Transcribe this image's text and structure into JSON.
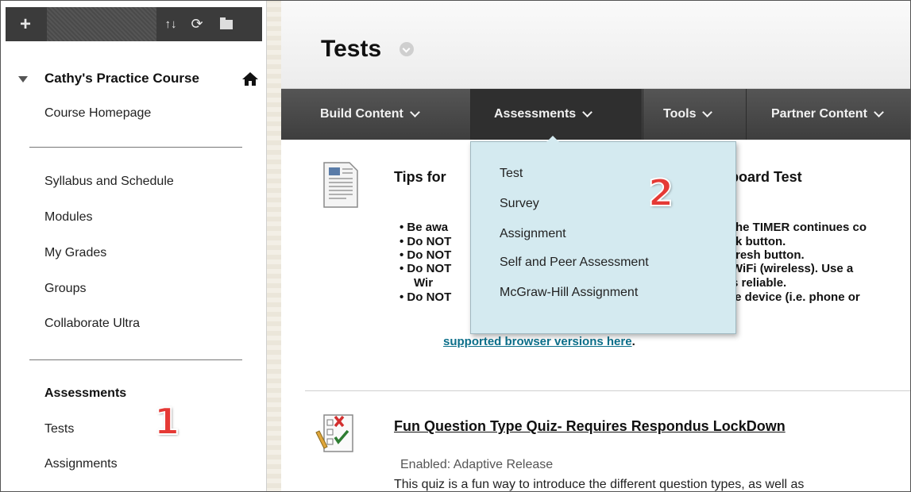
{
  "toolbar": {
    "plus_icon": "+",
    "sort_icon": "↑↓",
    "refresh_icon": "⟳"
  },
  "sidebar": {
    "course_name": "Cathy's Practice Course",
    "items_top": [
      "Course Homepage"
    ],
    "items_mid": [
      "Syllabus and Schedule",
      "Modules",
      "My Grades",
      "Groups",
      "Collaborate Ultra"
    ],
    "section_header": "Assessments",
    "items_bottom": [
      "Tests",
      "Assignments"
    ],
    "callout_number": "1"
  },
  "page": {
    "title": "Tests"
  },
  "actionbar": {
    "menus": [
      "Build Content",
      "Assessments",
      "Tools",
      "Partner Content"
    ]
  },
  "dropdown": {
    "items": [
      "Test",
      "Survey",
      "Assignment",
      "Self and Peer Assessment",
      "McGraw-Hill Assignment"
    ],
    "callout_number": "2"
  },
  "content": {
    "item1_title_start": "Tips for",
    "item1_title_end": "board Test",
    "bullets": [
      {
        "lead": "Be awa",
        "tail": "he TIMER continues co"
      },
      {
        "lead": "Do NOT",
        "tail": "k button."
      },
      {
        "lead": "Do NOT",
        "tail": "resh button."
      },
      {
        "lead": "Do NOT",
        "tail": "WiFi (wireless). Use a"
      },
      {
        "lead": "Wir",
        "tail": "s reliable."
      },
      {
        "lead": "Do NOT",
        "tail": "le device (i.e. phone or"
      }
    ],
    "link_text": "supported browser versions here",
    "link_suffix": ".",
    "quiz_title": "Fun Question Type Quiz- Requires Respondus LockDown",
    "quiz_meta": "Enabled:  Adaptive Release",
    "quiz_desc": "This quiz is a fun way to introduce the different question types, as well as"
  },
  "colors": {
    "accent_red": "#e53935",
    "dropdown_bg": "#d4eaf0",
    "actionbar": "#4a4a4a",
    "link": "#0c6f8a"
  }
}
